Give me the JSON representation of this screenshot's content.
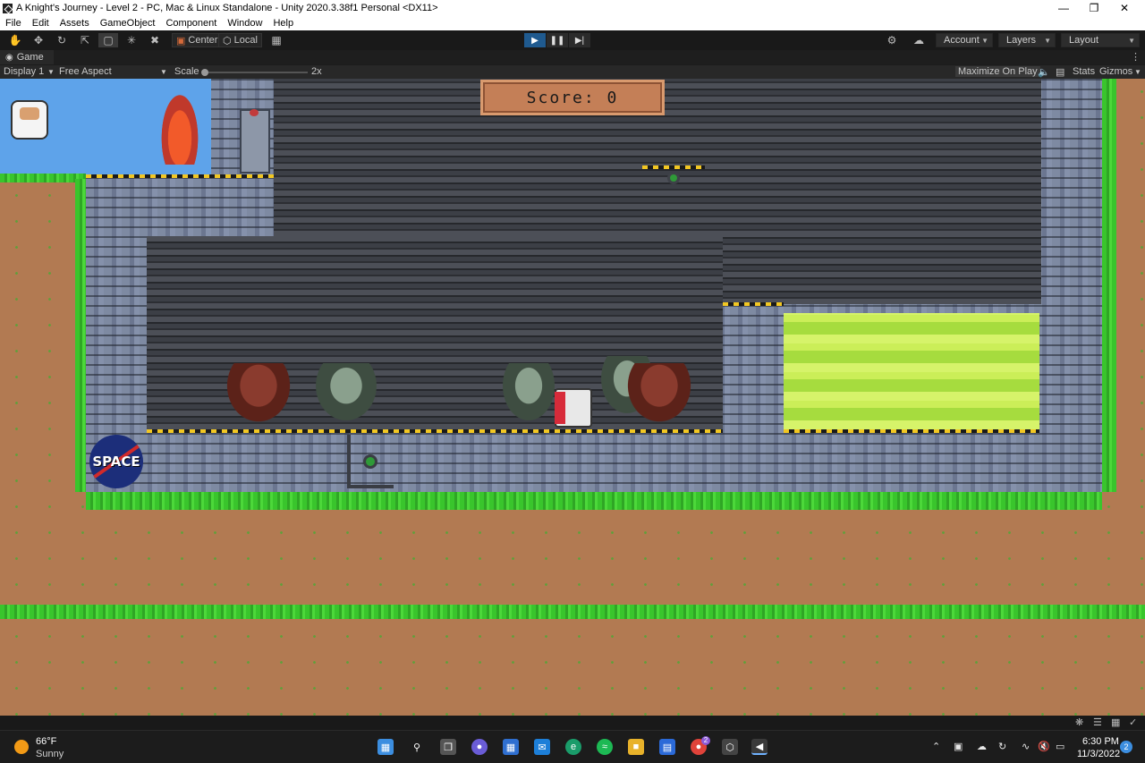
{
  "window": {
    "title": "A Knight's Journey - Level 2 - PC, Mac & Linux Standalone - Unity 2020.3.38f1 Personal <DX11>"
  },
  "menu": [
    "File",
    "Edit",
    "Assets",
    "GameObject",
    "Component",
    "Window",
    "Help"
  ],
  "toolbar": {
    "pivot_center": "Center",
    "pivot_local": "Local",
    "account": "Account",
    "layers": "Layers",
    "layout": "Layout"
  },
  "game_tab": {
    "label": "Game",
    "display": "Display 1",
    "aspect": "Free Aspect",
    "scale_label": "Scale",
    "scale_value": "2x",
    "maximize": "Maximize On Play",
    "stats": "Stats",
    "gizmos": "Gizmos"
  },
  "game": {
    "score_text": "Score: 0",
    "logo_text": "SPACE"
  },
  "taskbar": {
    "weather_temp": "66°F",
    "weather_desc": "Sunny",
    "time": "6:30 PM",
    "date": "11/3/2022",
    "notification_count": "2",
    "chrome_badge": "2"
  },
  "colors": {
    "play_active": "#1f5a8f",
    "grass": "#39c52c",
    "dirt": "#b27a52",
    "acid": "#a6dc3e"
  }
}
